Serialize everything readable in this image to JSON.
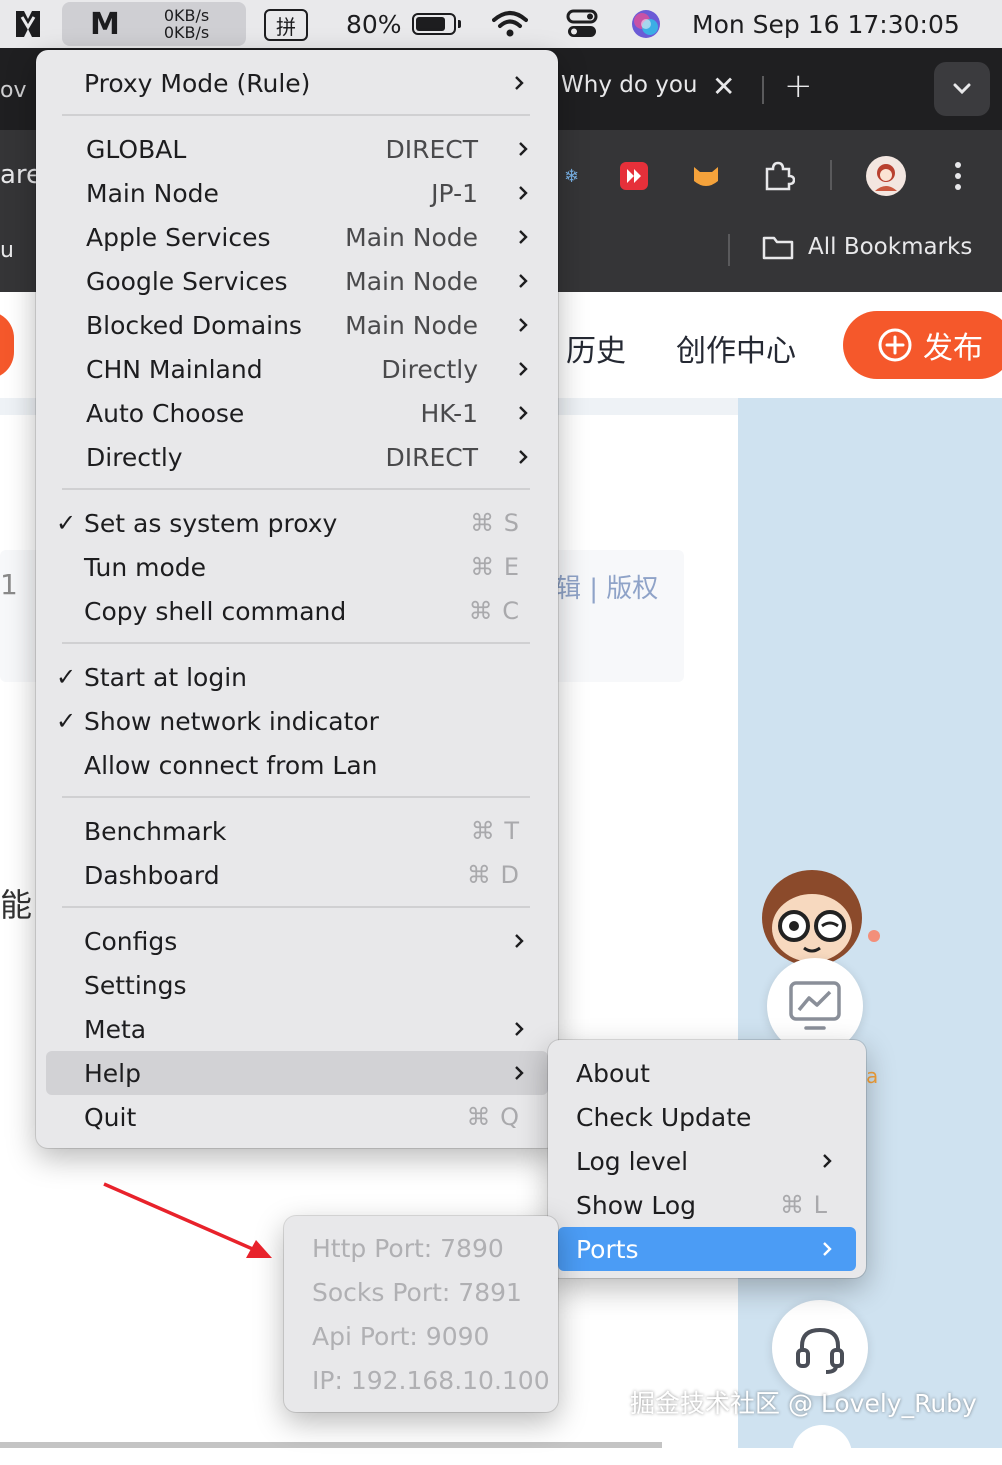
{
  "menubar": {
    "net_up": "0KB/s",
    "net_down": "0KB/s",
    "input_source": "拼",
    "battery": "80%",
    "battery_level": 0.8,
    "datetime": "Mon Sep 16  17:30:05"
  },
  "browser": {
    "tab_title": "Why do you",
    "bookmarks_label": "All Bookmarks",
    "left_fragments": [
      "ov",
      "are",
      "u"
    ]
  },
  "page": {
    "nav": [
      "历史",
      "创作中心"
    ],
    "publish_label": "发布",
    "links": "辑 | 版权",
    "frag_1": "1",
    "frag_2": "能",
    "frag_a": "a",
    "watermark": "掘金技术社区 @ Lovely_Ruby"
  },
  "proxy_menu": {
    "mode": "Proxy Mode (Rule)",
    "groups": [
      {
        "label": "GLOBAL",
        "value": "DIRECT"
      },
      {
        "label": "Main Node",
        "value": "JP-1"
      },
      {
        "label": "Apple Services",
        "value": "Main Node"
      },
      {
        "label": "Google Services",
        "value": "Main Node"
      },
      {
        "label": "Blocked Domains",
        "value": "Main Node"
      },
      {
        "label": "CHN Mainland",
        "value": "Directly"
      },
      {
        "label": "Auto Choose",
        "value": "HK-1"
      },
      {
        "label": "Directly",
        "value": "DIRECT"
      }
    ],
    "options": [
      {
        "label": "Set as system proxy",
        "shortcut": "⌘ S",
        "checked": true
      },
      {
        "label": "Tun mode",
        "shortcut": "⌘ E",
        "checked": false
      },
      {
        "label": "Copy shell command",
        "shortcut": "⌘ C",
        "checked": false
      }
    ],
    "toggles": [
      {
        "label": "Start at login",
        "checked": true
      },
      {
        "label": "Show network indicator",
        "checked": true
      },
      {
        "label": "Allow connect from Lan",
        "checked": false
      }
    ],
    "tools": [
      {
        "label": "Benchmark",
        "shortcut": "⌘ T"
      },
      {
        "label": "Dashboard",
        "shortcut": "⌘ D"
      }
    ],
    "configs": "Configs",
    "settings": "Settings",
    "meta": "Meta",
    "help": "Help",
    "quit": "Quit",
    "quit_shortcut": "⌘ Q"
  },
  "help_menu": {
    "about": "About",
    "check_update": "Check Update",
    "log_level": "Log level",
    "show_log": "Show Log",
    "show_log_shortcut": "⌘ L",
    "ports": "Ports"
  },
  "ports_menu": {
    "http": "Http Port: 7890",
    "socks": "Socks Port: 7891",
    "api": "Api Port: 9090",
    "ip": "IP: 192.168.10.100"
  },
  "colors": {
    "menu_bg": "#e8e8ea",
    "highlight_blue": "#4b9cf5",
    "publish_orange": "#f5582b",
    "arrow_red": "#e8222b"
  }
}
